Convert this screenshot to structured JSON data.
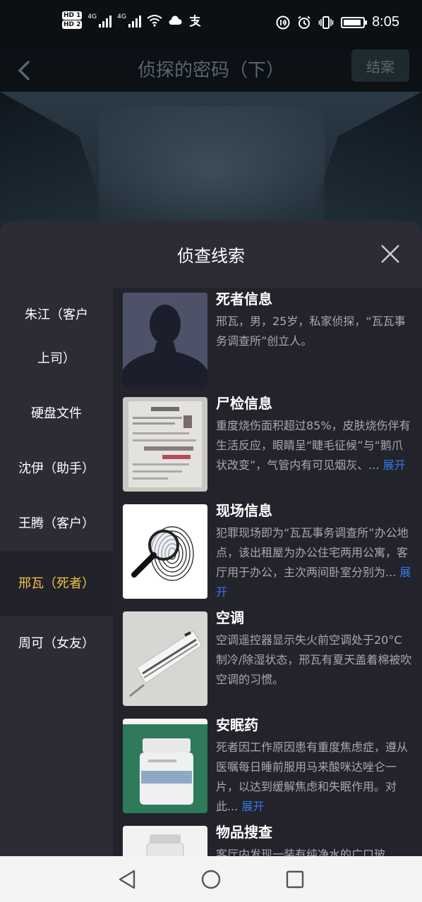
{
  "status_bar": {
    "hd1": "HD 1",
    "hd2": "HD 2",
    "net1": "4G",
    "net2": "4G",
    "time": "8:05",
    "icons": [
      "signal-icon",
      "wifi-icon",
      "cloud-icon",
      "alipay-icon",
      "nfc-icon",
      "alarm-icon",
      "vibrate-icon",
      "battery-icon"
    ]
  },
  "header": {
    "title": "侦探的密码（下）",
    "close_case_label": "结案"
  },
  "sheet": {
    "title": "侦查线索"
  },
  "sidebar": {
    "items": [
      {
        "label": "朱江（客户上司）",
        "active": false
      },
      {
        "label": "硬盘文件",
        "active": false
      },
      {
        "label": "沈伊（助手）",
        "active": false
      },
      {
        "label": "王腾（客户）",
        "active": false
      },
      {
        "label": "邢瓦（死者）",
        "active": true
      },
      {
        "label": "周可（女友）",
        "active": false
      }
    ]
  },
  "clues": [
    {
      "title": "死者信息",
      "desc": "邢瓦，男，25岁，私家侦探，“瓦瓦事务调查所”创立人。",
      "expand": ""
    },
    {
      "title": "尸检信息",
      "desc": "重度烧伤面积超过85%，皮肤烧伤伴有生活反应，眼睛呈“睫毛征候”与“鹅爪状改变”，气管内有可见烟灰、...",
      "expand": "展开"
    },
    {
      "title": "现场信息",
      "desc": "犯罪现场即为“瓦瓦事务调查所”办公地点，该出租屋为办公住宅两用公寓，客厅用于办公，主次两间卧室分别为...",
      "expand": "展开"
    },
    {
      "title": "空调",
      "desc": "空调遥控器显示失火前空调处于20°C制冷/除湿状态，邢瓦有夏天盖着棉被吹空调的习惯。",
      "expand": ""
    },
    {
      "title": "安眠药",
      "desc": "死者因工作原因患有重度焦虑症，遵从医嘱每日睡前服用马来酸咪达唑仑一片，以达到缓解焦虑和失眠作用。对此...",
      "expand": "展开"
    },
    {
      "title": "物品搜查",
      "desc": "客厅内发现一装有纯净水的广口玻",
      "expand": ""
    }
  ],
  "colors": {
    "accent": "#f4c248",
    "link": "#2f7be8",
    "sheet_bg": "#2c2b36",
    "list_bg": "#23232b"
  }
}
